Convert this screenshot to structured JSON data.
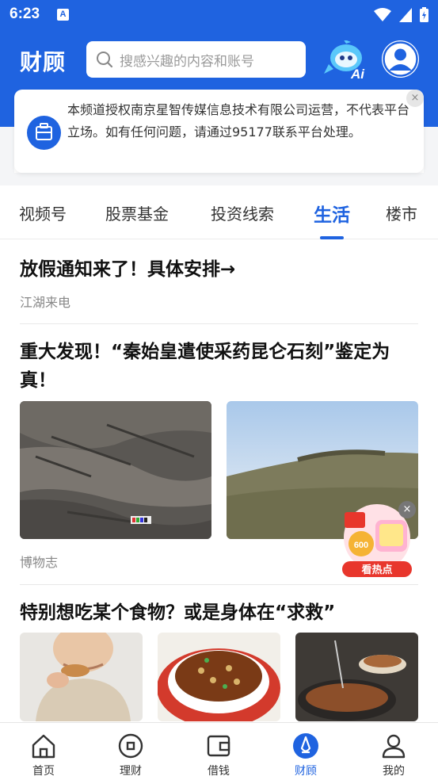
{
  "status": {
    "time": "6:23",
    "notif_letter": "A"
  },
  "header": {
    "brand": "财顾",
    "search_placeholder": "搜感兴趣的内容和账号",
    "ai_label": "Ai"
  },
  "notice": {
    "text": "本频道授权南京星智传媒信息技术有限公司运营，不代表平台立场。如有任何问题，请通过95177联系平台处理。",
    "close": "×"
  },
  "tabs": [
    {
      "label": "视频号"
    },
    {
      "label": "股票基金"
    },
    {
      "label": "投资线索"
    },
    {
      "label": "生活"
    },
    {
      "label": "楼市"
    }
  ],
  "active_tab": "生活",
  "feed": [
    {
      "title": "放假通知来了！具体安排→",
      "source": "江湖来电"
    },
    {
      "title": "重大发现！“秦始皇遣使采药昆仑石刻”鉴定为真！",
      "source": "博物志"
    },
    {
      "title": "特别想吃某个食物？或是身体在“求救”",
      "source": ""
    }
  ],
  "promo": {
    "badge": "600",
    "button": "看热点",
    "close": "×"
  },
  "bottom_nav": [
    {
      "label": "首页"
    },
    {
      "label": "理财"
    },
    {
      "label": "借钱"
    },
    {
      "label": "财顾"
    },
    {
      "label": "我的"
    }
  ],
  "colors": {
    "brand_blue": "#1f63e0",
    "promo_red": "#e8362c"
  }
}
